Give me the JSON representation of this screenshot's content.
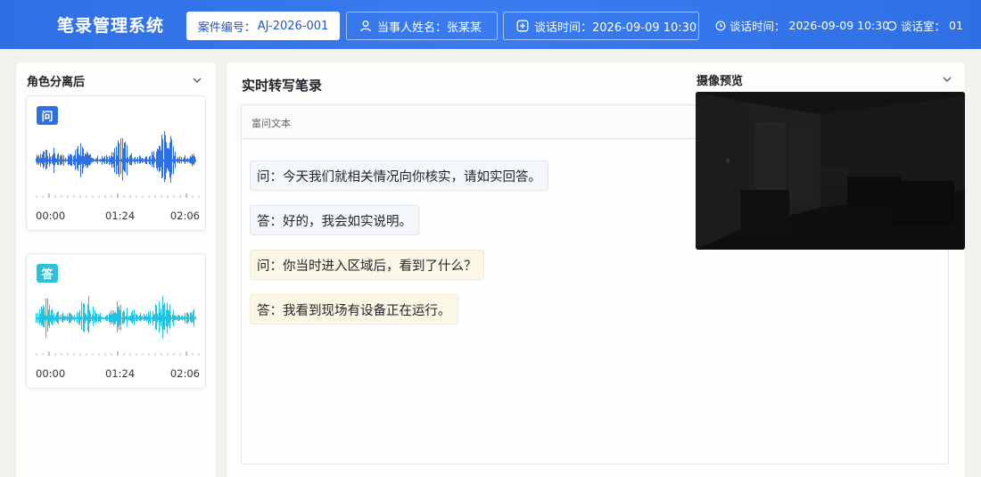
{
  "header": {
    "title": "笔录管理系统",
    "case_label": "案件编号：",
    "case_no": "AJ-2026-001",
    "party_label": "当事人姓名：",
    "party_name": "张某某",
    "time_box_label": "谈话时间：",
    "time_box_value": "2026-09-09 10:30",
    "info_time_label": "谈话时间：",
    "info_time_value": "2026-09-09 10:30",
    "room_label": "谈话室：",
    "room_value": "01",
    "icons": [
      "user-icon",
      "plus-square-icon",
      "clock-icon",
      "circle-icon"
    ]
  },
  "left_panel": {
    "title": "角色分离后",
    "tracks": [
      {
        "role": "问",
        "color": "#2f6fe4",
        "wave_color": "#2f6fe4",
        "times": [
          "00:00",
          "01:24",
          "02:06"
        ]
      },
      {
        "role": "答",
        "color": "#2bc1d8",
        "wave_color": "#22c3e0",
        "times": [
          "00:00",
          "01:24",
          "02:06"
        ]
      }
    ]
  },
  "main_panel": {
    "title": "实时转写笔录",
    "toolbar_label": "富问文本",
    "lines": [
      {
        "text": "问：今天我们就相关情况向你核实，请如实回答。"
      },
      {
        "text": "答：好的，我会如实说明。"
      },
      {
        "text": "问：你当时进入区域后，看到了什么？"
      },
      {
        "text": "答：我看到现场有设备正在运行。"
      }
    ]
  },
  "camera": {
    "title": "摄像预览"
  }
}
